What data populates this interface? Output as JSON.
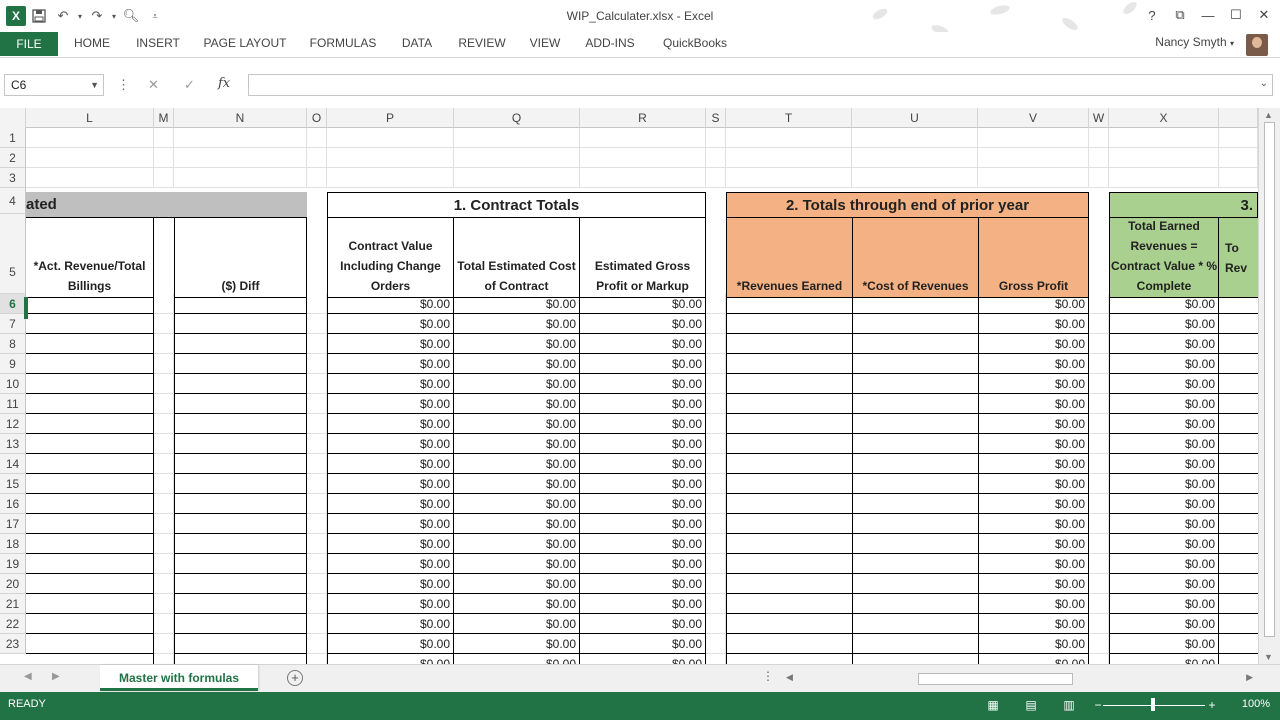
{
  "window": {
    "title": "WIP_Calculater.xlsx - Excel",
    "user_name": "Nancy Smyth"
  },
  "ribbon": {
    "tabs": [
      "FILE",
      "HOME",
      "INSERT",
      "PAGE LAYOUT",
      "FORMULAS",
      "DATA",
      "REVIEW",
      "VIEW",
      "ADD-INS",
      "QuickBooks"
    ]
  },
  "formula_bar": {
    "name_box": "C6",
    "fx_label": "fx",
    "formula": ""
  },
  "columns": [
    "L",
    "M",
    "N",
    "O",
    "P",
    "Q",
    "R",
    "S",
    "T",
    "U",
    "V",
    "W",
    "X"
  ],
  "rows": [
    "1",
    "2",
    "3",
    "4",
    "5",
    "6",
    "7",
    "8",
    "9",
    "10",
    "11",
    "12",
    "13",
    "14",
    "15",
    "16",
    "17",
    "18",
    "19",
    "20",
    "21",
    "22",
    "23"
  ],
  "sections": {
    "estimated_partial": "ated",
    "contract_totals": "1.  Contract Totals",
    "prior_year": "2.  Totals through end of prior year",
    "section3_partial": "3."
  },
  "headers": {
    "L": "*Act. Revenue/Total Billings",
    "N": "($) Diff",
    "P": "Contract Value Including Change Orders",
    "Q": "Total Estimated Cost of Contract",
    "R": "Estimated Gross Profit or Markup",
    "T": "*Revenues Earned",
    "U": "*Cost of Revenues",
    "V": "Gross Profit",
    "X": "Total Earned Revenues = Contract Value * % Complete",
    "Y_partial": "To Rev"
  },
  "cell_value": "$0.00",
  "colors": {
    "accent": "#217346",
    "section_gray": "#bfbfbf",
    "section_orange": "#f4b183",
    "section_green": "#a9d08e"
  },
  "sheet_tab": "Master with formulas",
  "status": {
    "ready": "READY",
    "zoom": "100%"
  }
}
